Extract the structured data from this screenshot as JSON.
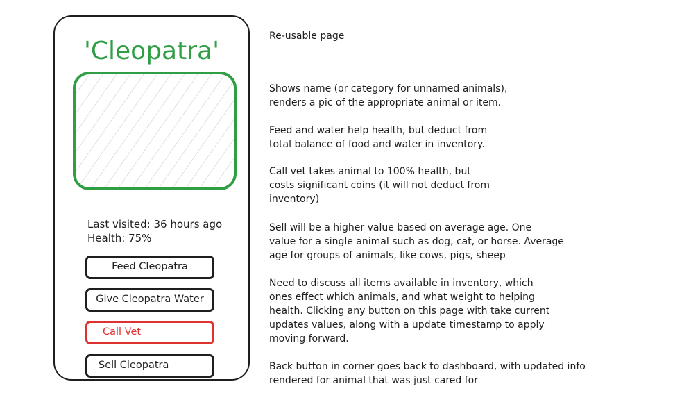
{
  "screen": {
    "animal_name": "'Cleopatra'",
    "last_visited": "Last visited: 36 hours ago",
    "health": "Health: 75%",
    "buttons": {
      "feed": "Feed Cleopatra",
      "water": "Give Cleopatra Water",
      "vet": "Call Vet",
      "sell": "Sell Cleopatra"
    },
    "colors": {
      "name": "#2f9e44",
      "picture_border": "#2f9e44",
      "vet_button": "#e03131",
      "outline": "#1e1e1e"
    }
  },
  "notes": {
    "title": "Re-usable page",
    "items": [
      "Shows name (or category for unnamed animals),\nrenders a pic of the appropriate animal or item.",
      "Feed and water help health, but deduct from\ntotal balance of food and water in inventory.",
      "Call vet takes animal to 100% health, but\ncosts significant coins (it will not deduct from\ninventory)",
      "Sell will be a higher value based on average age. One\nvalue for a single animal such as dog, cat, or horse. Average\nage for groups of animals, like cows, pigs, sheep",
      "Need to discuss all items available in inventory, which\nones effect which animals, and what weight to helping\nhealth. Clicking any button on this page with take current\nupdates values, along with a update timestamp to apply\nmoving forward.",
      "Back button in corner goes back to dashboard, with updated info\nrendered for animal that was just cared for"
    ]
  }
}
